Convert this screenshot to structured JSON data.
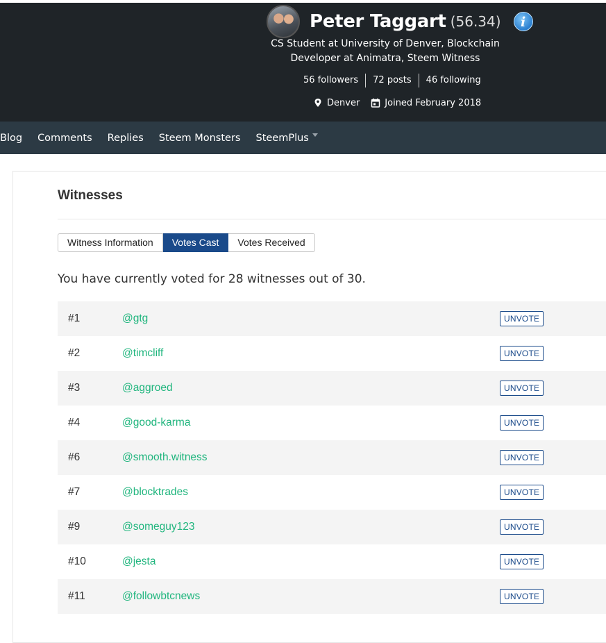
{
  "profile": {
    "name": "Peter Taggart",
    "reputation": "(56.34)",
    "bio": "CS Student at University of Denver, Blockchain Developer at Animatra, Steem Witness",
    "followers": "56 followers",
    "posts": "72 posts",
    "following": "46 following",
    "location": "Denver",
    "joined": "Joined February 2018"
  },
  "nav": {
    "items": [
      "Blog",
      "Comments",
      "Replies",
      "Steem Monsters",
      "SteemPlus"
    ]
  },
  "witnesses": {
    "title": "Witnesses",
    "tabs": [
      {
        "label": "Witness Information",
        "active": false
      },
      {
        "label": "Votes Cast",
        "active": true
      },
      {
        "label": "Votes Received",
        "active": false
      }
    ],
    "summary": "You have currently voted for 28 witnesses out of 30.",
    "unvote_label": "UNVOTE",
    "rows": [
      {
        "rank": "#1",
        "name": "@gtg"
      },
      {
        "rank": "#2",
        "name": "@timcliff"
      },
      {
        "rank": "#3",
        "name": "@aggroed"
      },
      {
        "rank": "#4",
        "name": "@good-karma"
      },
      {
        "rank": "#6",
        "name": "@smooth.witness"
      },
      {
        "rank": "#7",
        "name": "@blocktrades"
      },
      {
        "rank": "#9",
        "name": "@someguy123"
      },
      {
        "rank": "#10",
        "name": "@jesta"
      },
      {
        "rank": "#11",
        "name": "@followbtcnews"
      }
    ]
  },
  "colors": {
    "header_bg": "#1f2428",
    "nav_bg": "#2c3a44",
    "accent_blue": "#1a4a8a",
    "link_green": "#1fb57d"
  }
}
